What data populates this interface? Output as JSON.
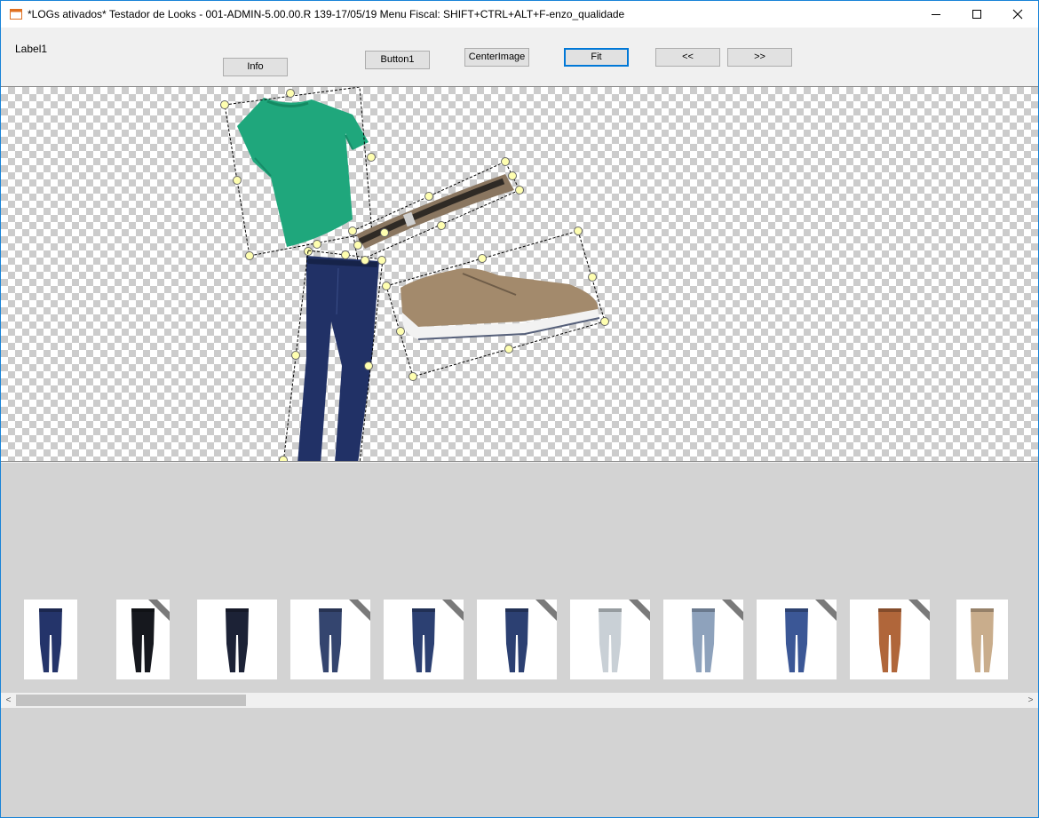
{
  "window": {
    "title": "*LOGs ativados* Testador de Looks - 001-ADMIN-5.00.00.R 139-17/05/19 Menu Fiscal: SHIFT+CTRL+ALT+F-enzo_qualidade",
    "icon": "app-window-icon",
    "controls": [
      "minimize-icon",
      "maximize-icon",
      "close-icon"
    ]
  },
  "toolbar": {
    "label1": "Label1",
    "info_label": "Info",
    "button1_label": "Button1",
    "centerimage_label": "CenterImage",
    "fit_label": "Fit",
    "prev_label": "<<",
    "next_label": ">>"
  },
  "canvas": {
    "items": [
      "green-tshirt",
      "brown-belt",
      "brown-sneaker",
      "blue-jeans"
    ]
  },
  "gallery": {
    "thumbnails": [
      {
        "item": "dark-blue-jeans",
        "ribbon": false
      },
      {
        "item": "black-jeans",
        "ribbon": true
      },
      {
        "item": "dark-jeans",
        "ribbon": false
      },
      {
        "item": "washed-blue-jeans",
        "ribbon": true
      },
      {
        "item": "blue-jeans",
        "ribbon": true
      },
      {
        "item": "blue-jeans",
        "ribbon": true
      },
      {
        "item": "light-grey-jeans",
        "ribbon": true
      },
      {
        "item": "light-blue-jeans",
        "ribbon": true
      },
      {
        "item": "medium-blue-jeans",
        "ribbon": true
      },
      {
        "item": "rust-brown-pants",
        "ribbon": true
      },
      {
        "item": "khaki-pants",
        "ribbon": false
      }
    ],
    "scrollbar": {
      "left_arrow": "<",
      "right_arrow": ">"
    }
  },
  "colors": {
    "accent": "#0078d7",
    "window_border": "#1883d7",
    "handle": "#ffffb0",
    "gallery_bg": "#d3d3d3"
  }
}
